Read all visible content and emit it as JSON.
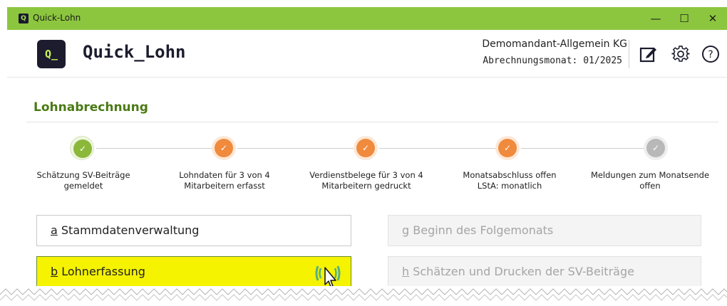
{
  "window": {
    "title": "Quick-Lohn",
    "app_icon_letter": "Q",
    "controls": {
      "minimize": "—",
      "maximize": "☐",
      "close": "✕"
    }
  },
  "header": {
    "logo_text": "Q_",
    "brand": "Quick_Lohn",
    "company": "Demomandant-Allgemein KG",
    "month_label": "Abrechnungsmonat: 01/2025",
    "icons": [
      "edit-icon",
      "gear-icon",
      "help-icon"
    ]
  },
  "section": {
    "title": "Lohnabrechnung"
  },
  "steps": [
    {
      "status": "done-green",
      "label_line1": "Schätzung SV-Beiträge",
      "label_line2": "gemeldet",
      "color": "#8cb83a"
    },
    {
      "status": "done-orange",
      "label_line1": "Lohndaten für 3 von 4",
      "label_line2": "Mitarbeitern erfasst",
      "color": "#f08a3c"
    },
    {
      "status": "done-orange",
      "label_line1": "Verdienstbelege für 3 von 4",
      "label_line2": "Mitarbeitern gedruckt",
      "color": "#f08a3c"
    },
    {
      "status": "done-orange",
      "label_line1": "Monatsabschluss offen",
      "label_line2": "LStA: monatlich",
      "color": "#f08a3c"
    },
    {
      "status": "pending-gray",
      "label_line1": "Meldungen zum Monatsende",
      "label_line2": "offen",
      "color": "#b8b8b8"
    }
  ],
  "actions": [
    {
      "key": "a",
      "label": " Stammdatenverwaltung",
      "state": "active"
    },
    {
      "key": "b",
      "label": " Lohnerfassung",
      "state": "selected"
    },
    {
      "key": "g",
      "label": " Beginn des Folgemonats",
      "state": "disabled"
    },
    {
      "key": "h",
      "label": " Schätzen und Drucken der SV-Beiträge",
      "state": "disabled"
    }
  ],
  "colors": {
    "titlebar": "#8cc63f",
    "brand_dark": "#1c1c2e",
    "section_title": "#4a7a14",
    "selected_fill": "#f5f300"
  }
}
